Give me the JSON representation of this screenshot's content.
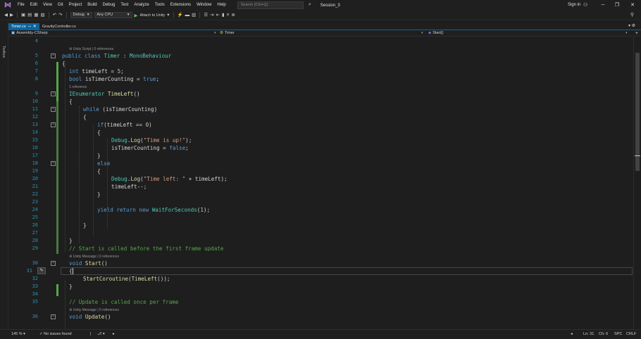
{
  "menubar": {
    "logo_icon": "visual-studio-logo-icon",
    "items": [
      "File",
      "Edit",
      "View",
      "Git",
      "Project",
      "Build",
      "Debug",
      "Test",
      "Analyze",
      "Tools",
      "Extensions",
      "Window",
      "Help"
    ],
    "search_placeholder": "Search (Ctrl+Q)",
    "session": "Session_3",
    "signin": "Sign in"
  },
  "toolbar": {
    "configuration": "Debug",
    "platform": "Any CPU",
    "attach_label": "Attach to Unity"
  },
  "toolbox_label": "Toolbox",
  "tabs": [
    {
      "label": "Timer.cs",
      "active": true
    },
    {
      "label": "GravityController.cs",
      "active": false
    }
  ],
  "navbar": {
    "project": "Assembly-CSharp",
    "class": "Timer",
    "member": "Start()"
  },
  "editor": {
    "lens_unity_script": "Unity Script | 0 references",
    "lens_1_reference": "1 reference",
    "lens_unity_message": "Unity Message | 0 references",
    "line_numbers": [
      "4",
      "5",
      "6",
      "7",
      "8",
      "9",
      "10",
      "11",
      "12",
      "13",
      "14",
      "15",
      "16",
      "17",
      "18",
      "19",
      "20",
      "21",
      "22",
      "23",
      "24",
      "25",
      "26",
      "27",
      "28",
      "29",
      "30",
      "31",
      "32",
      "33",
      "34",
      "35",
      "36"
    ]
  },
  "statusbar": {
    "zoom": "145 %",
    "issues": "No issues found",
    "position_ln": "Ln: 31",
    "position_ch": "Ch: 6",
    "whitespace": "SPC",
    "line_ending": "CRLF"
  }
}
